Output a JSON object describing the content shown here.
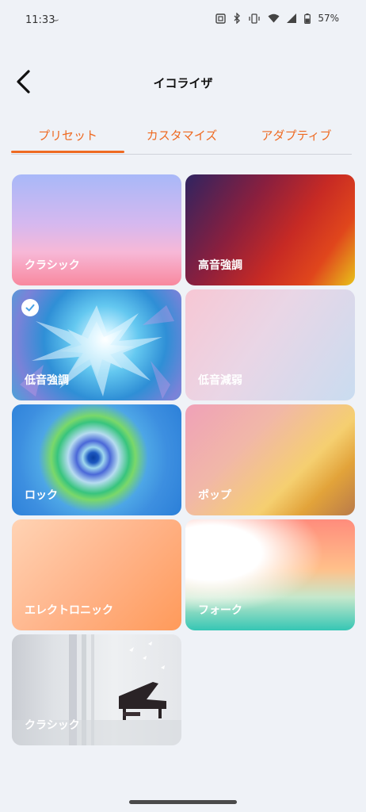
{
  "status_bar": {
    "time": "11:33",
    "time_icon": "⌣",
    "battery": "57%",
    "icons": [
      "nfc-icon",
      "bluetooth-icon",
      "vibrate-icon",
      "wifi-icon",
      "signal-icon",
      "battery-icon"
    ]
  },
  "header": {
    "title": "イコライザ",
    "back_icon": "back-arrow-icon"
  },
  "tabs": [
    {
      "label": "プリセット",
      "active": true
    },
    {
      "label": "カスタマイズ",
      "active": false
    },
    {
      "label": "アダプティブ",
      "active": false
    }
  ],
  "accent_color": "#ee6a22",
  "presets": [
    {
      "label": "クラシック",
      "selected": false
    },
    {
      "label": "高音強調",
      "selected": false
    },
    {
      "label": "低音強調",
      "selected": true
    },
    {
      "label": "低音減弱",
      "selected": false
    },
    {
      "label": "ロック",
      "selected": false
    },
    {
      "label": "ポップ",
      "selected": false
    },
    {
      "label": "エレクトロニック",
      "selected": false
    },
    {
      "label": "フォーク",
      "selected": false
    },
    {
      "label": "クラシック",
      "selected": false
    }
  ]
}
